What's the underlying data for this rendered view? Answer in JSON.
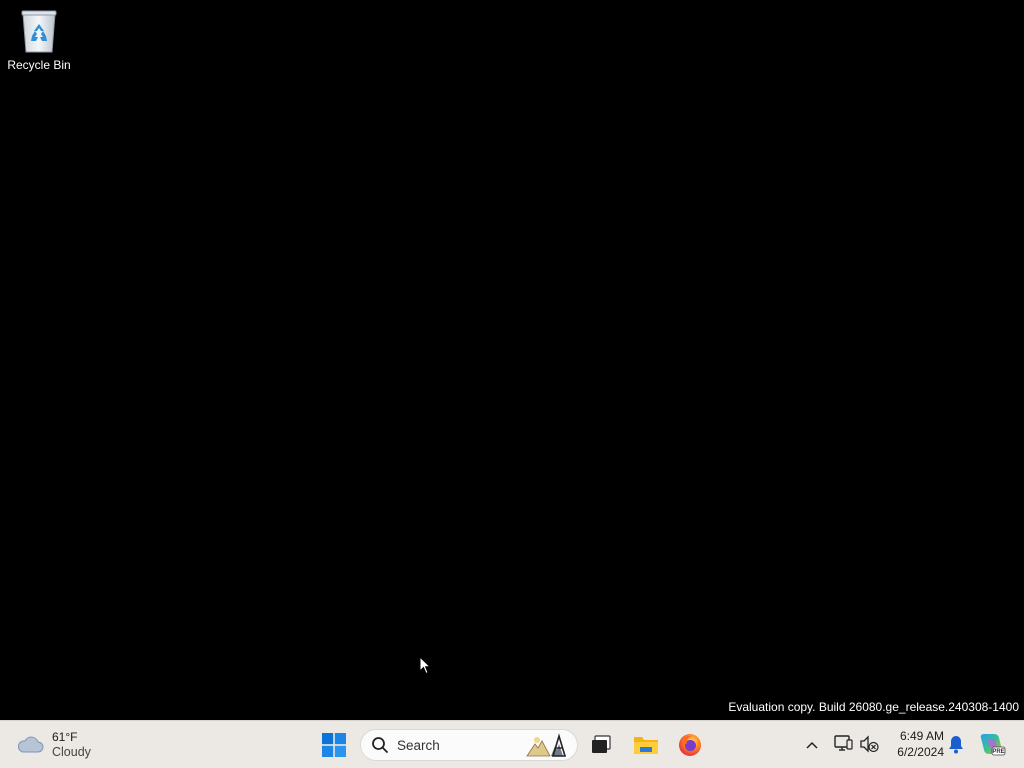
{
  "desktop": {
    "icons": [
      {
        "label": "Recycle Bin",
        "icon": "recycle-bin-icon"
      }
    ],
    "watermark": "Evaluation copy. Build 26080.ge_release.240308-1400"
  },
  "taskbar": {
    "weather": {
      "temperature": "61°F",
      "condition": "Cloudy",
      "icon": "cloud-icon"
    },
    "start_icon": "windows-start-icon",
    "search": {
      "placeholder": "Search",
      "icon": "search-icon"
    },
    "pinned": [
      {
        "name": "Task View",
        "icon": "task-view-icon"
      },
      {
        "name": "File Explorer",
        "icon": "folder-icon"
      },
      {
        "name": "Firefox",
        "icon": "firefox-icon"
      }
    ],
    "tray": {
      "time": "6:49 AM",
      "date": "6/2/2024"
    }
  },
  "colors": {
    "taskbar_bg": "#ece9e4",
    "desktop_bg": "#000000",
    "windows_blue": "#0a74d9",
    "notification_blue": "#1a5fd0"
  }
}
